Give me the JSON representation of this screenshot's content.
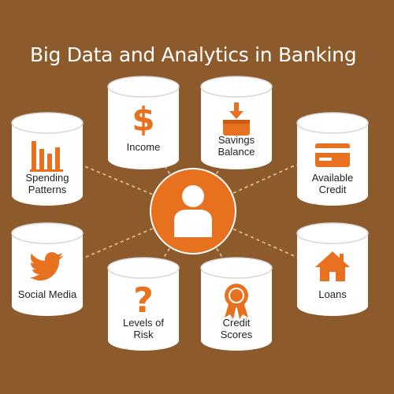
{
  "title": "Big Data and Analytics in Banking",
  "colors": {
    "background": "#8d5a2c",
    "accent": "#e8711f",
    "cylinder": "#ffffff",
    "line": "#d9b08a"
  },
  "center": {
    "icon": "person-icon"
  },
  "nodes": [
    {
      "id": "spending-patterns",
      "icon": "bar-chart-icon",
      "line1": "Spending",
      "line2": "Patterns"
    },
    {
      "id": "income",
      "icon": "dollar-icon",
      "line1": "Income",
      "line2": ""
    },
    {
      "id": "savings-balance",
      "icon": "deposit-icon",
      "line1": "Savings",
      "line2": "Balance"
    },
    {
      "id": "available-credit",
      "icon": "credit-card-icon",
      "line1": "Available",
      "line2": "Credit"
    },
    {
      "id": "social-media",
      "icon": "bird-icon",
      "line1": "Social Media",
      "line2": ""
    },
    {
      "id": "levels-of-risk",
      "icon": "question-mark-icon",
      "line1": "Levels of",
      "line2": "Risk"
    },
    {
      "id": "credit-scores",
      "icon": "ribbon-badge-icon",
      "line1": "Credit",
      "line2": "Scores"
    },
    {
      "id": "loans",
      "icon": "house-icon",
      "line1": "Loans",
      "line2": ""
    }
  ]
}
